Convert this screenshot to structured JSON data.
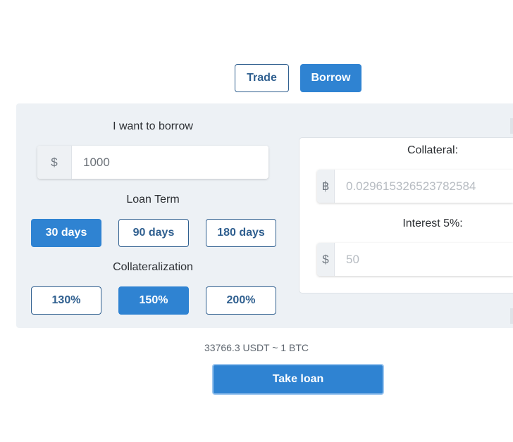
{
  "tabs": [
    {
      "label": "Trade",
      "active": false
    },
    {
      "label": "Borrow",
      "active": true
    }
  ],
  "borrow": {
    "heading": "I want to borrow",
    "currency_prefix": "$",
    "amount_value": "1000"
  },
  "loan_term": {
    "heading": "Loan Term",
    "options": [
      "30 days",
      "90 days",
      "180 days"
    ],
    "selected": "30 days"
  },
  "collateralization": {
    "heading": "Collateralization",
    "options": [
      "130%",
      "150%",
      "200%"
    ],
    "selected": "150%"
  },
  "collateral": {
    "heading": "Collateral:",
    "prefix": "฿",
    "value": "0.029615326523782584"
  },
  "interest": {
    "heading": "Interest 5%:",
    "prefix": "$",
    "value": "50"
  },
  "rate_text": "33766.3 USDT ~ 1 BTC",
  "take_loan_label": "Take loan",
  "colors": {
    "accent": "#2f83d2",
    "outline": "#2f5f8f",
    "panel_bg": "#edf1f5"
  }
}
